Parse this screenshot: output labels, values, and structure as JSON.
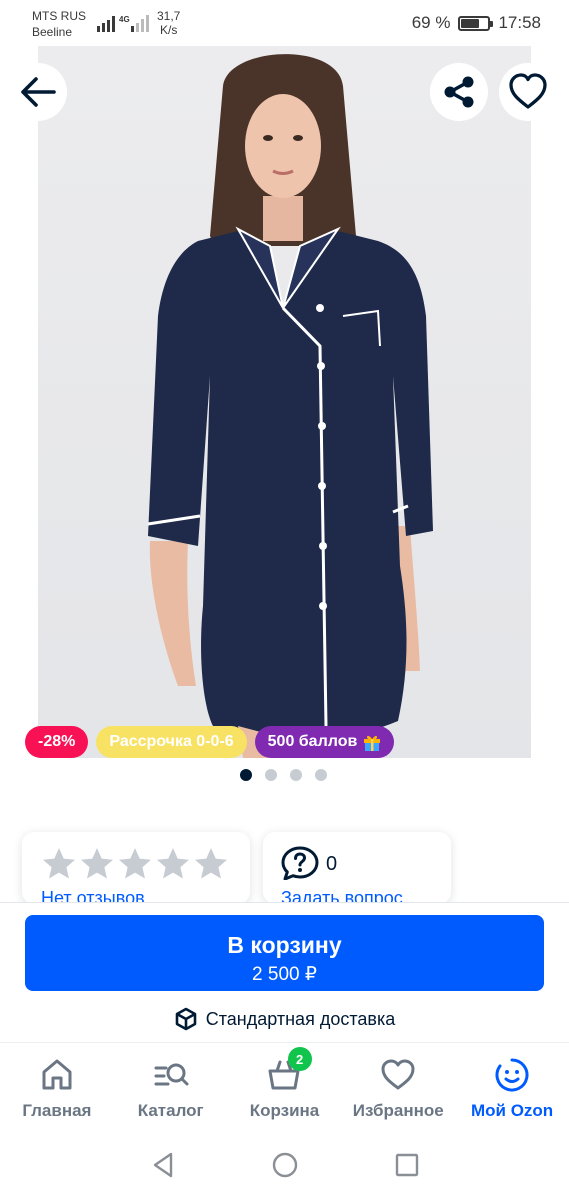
{
  "status_bar": {
    "carrier_line1": "MTS RUS",
    "carrier_line2": "Beeline",
    "network": "4G",
    "speed_value": "31,7",
    "speed_unit": "K/s",
    "battery_percent": "69 %",
    "battery_level": 0.69,
    "time": "17:58"
  },
  "product": {
    "image_icon": "product-photo-navy-shirt-dress",
    "image_count": 4,
    "active_image": 1,
    "badges": {
      "discount": "-28%",
      "installment": "Рассрочка 0-0-6",
      "points": "500 баллов"
    },
    "rating": {
      "stars_filled": 0,
      "stars_total": 5,
      "reviews_link": "Нет отзывов"
    },
    "questions": {
      "count": "0",
      "ask_link": "Задать вопрос"
    }
  },
  "header_actions": {
    "back_icon": "arrow-left-icon",
    "share_icon": "share-icon",
    "favorite_icon": "heart-icon"
  },
  "buy_panel": {
    "button_label": "В корзину",
    "price": "2 500 ₽",
    "delivery_label": "Стандартная доставка"
  },
  "tabs": [
    {
      "label": "Главная",
      "icon": "home-icon"
    },
    {
      "label": "Каталог",
      "icon": "catalog-search-icon"
    },
    {
      "label": "Корзина",
      "icon": "basket-icon",
      "badge": "2"
    },
    {
      "label": "Избранное",
      "icon": "heart-icon"
    },
    {
      "label": "Мой Ozon",
      "icon": "smiley-icon",
      "active": true
    }
  ],
  "colors": {
    "accent": "#005bff",
    "discount": "#f91155",
    "installment": "#f8e264",
    "points": "#7f2ab1",
    "cart_badge": "#10c44c",
    "text_primary": "#001a34"
  }
}
